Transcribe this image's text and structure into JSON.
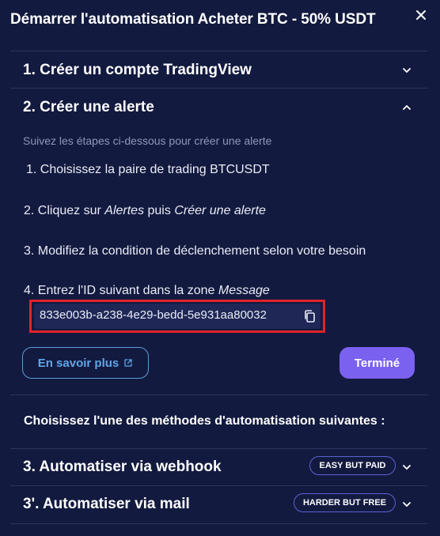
{
  "header": {
    "title": "Démarrer l'automatisation Acheter BTC - 50% USDT",
    "close_icon": "close-icon"
  },
  "sections": [
    {
      "label": "1. Créer un compte TradingView",
      "state": "collapsed"
    },
    {
      "label": "2. Créer une alerte",
      "state": "expanded"
    }
  ],
  "alert_section": {
    "hint": "Suivez les étapes ci-dessous pour créer une alerte",
    "steps": [
      {
        "text": "1. Choisissez la paire de trading BTCUSDT"
      },
      {
        "pre": "2. Cliquez sur ",
        "em1": "Alertes",
        "mid": " puis ",
        "em2": "Créer une alerte"
      },
      {
        "text": "3. Modifiez la condition de déclenchement selon votre besoin"
      },
      {
        "pre": "4. Entrez l'ID suivant dans la zone ",
        "em1": "Message"
      }
    ],
    "alert_id": "833e003b-a238-4e29-bedd-5e931aa80032",
    "learn_more_label": "En savoir plus",
    "done_label": "Terminé"
  },
  "methods_heading": "Choisissez l'une des méthodes d'automatisation suivantes :",
  "methods": [
    {
      "label": "3. Automatiser via webhook",
      "badge": "EASY BUT PAID"
    },
    {
      "label": "3'. Automatiser via mail",
      "badge": "HARDER BUT FREE"
    }
  ],
  "colors": {
    "background": "#131a3f",
    "divider": "#2c3561",
    "accent": "#7b61f0",
    "link": "#5fa6ea",
    "highlight": "#e0232b",
    "badge_border": "#5b62d6"
  }
}
